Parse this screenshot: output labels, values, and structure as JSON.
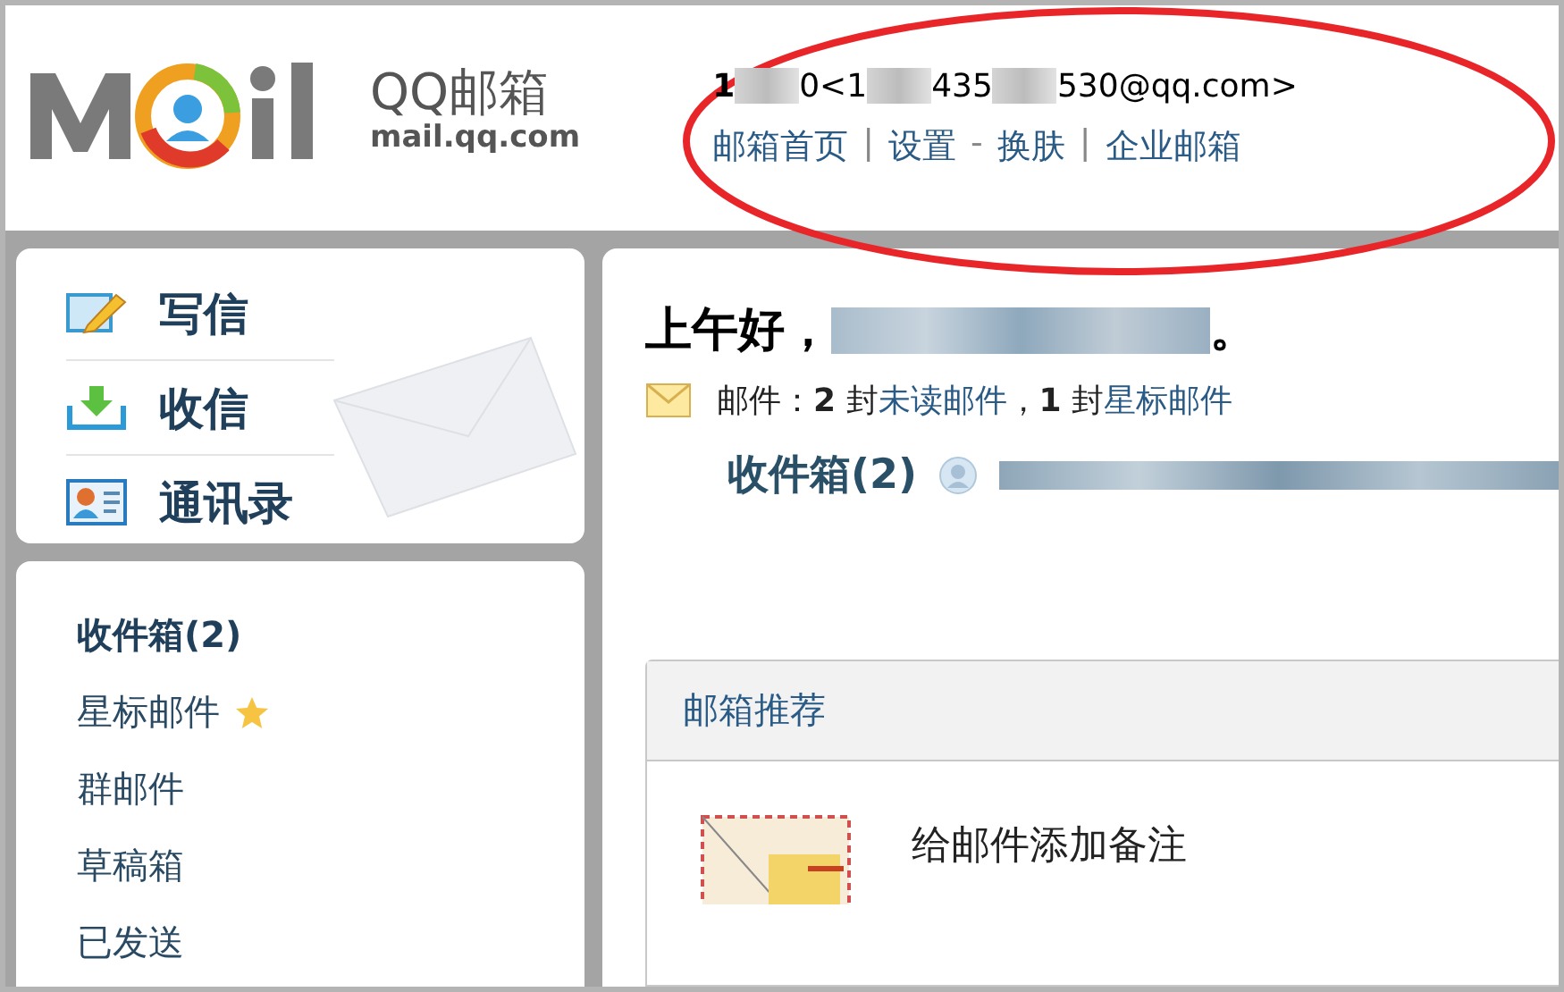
{
  "logo": {
    "brand": "QQ邮箱",
    "domain": "mail.qq.com"
  },
  "account": [
    {
      "kind": "text",
      "text": "1"
    },
    {
      "kind": "redacted"
    },
    {
      "kind": "text",
      "text": "0<1"
    },
    {
      "kind": "redacted"
    },
    {
      "kind": "text",
      "text": "435"
    },
    {
      "kind": "redacted"
    },
    {
      "kind": "text",
      "text": "530@qq.com>"
    }
  ],
  "top_links": [
    {
      "kind": "link",
      "text": "邮箱首页"
    },
    {
      "kind": "sep",
      "text": "|"
    },
    {
      "kind": "link",
      "text": "设置"
    },
    {
      "kind": "sep",
      "text": "-"
    },
    {
      "kind": "link",
      "text": "换肤"
    },
    {
      "kind": "sep",
      "text": "|"
    },
    {
      "kind": "link",
      "text": "企业邮箱"
    }
  ],
  "annotation": {
    "kind": "ellipse",
    "color": "#e8262a"
  },
  "actions": [
    {
      "kind": "compose",
      "label": "写信"
    },
    {
      "kind": "receive",
      "label": "收信"
    },
    {
      "kind": "contacts",
      "label": "通讯录"
    }
  ],
  "folders": [
    {
      "label": "收件箱(2)",
      "selected": true,
      "starred": false
    },
    {
      "label": "星标邮件",
      "selected": false,
      "starred": true
    },
    {
      "label": "群邮件",
      "selected": false,
      "starred": false
    },
    {
      "label": "草稿箱",
      "selected": false,
      "starred": false
    },
    {
      "label": "已发送",
      "selected": false,
      "starred": false
    }
  ],
  "greeting": {
    "text": "上午好，",
    "end": "。"
  },
  "summary": [
    {
      "kind": "text",
      "text": "邮件：**2** 封"
    },
    {
      "kind": "link",
      "text": "未读邮件"
    },
    {
      "kind": "text",
      "text": "，**1** 封"
    },
    {
      "kind": "link",
      "text": "星标邮件"
    }
  ],
  "inbox_link": "收件箱(2)",
  "recommend": {
    "title": "邮箱推荐",
    "item": "给邮件添加备注"
  }
}
